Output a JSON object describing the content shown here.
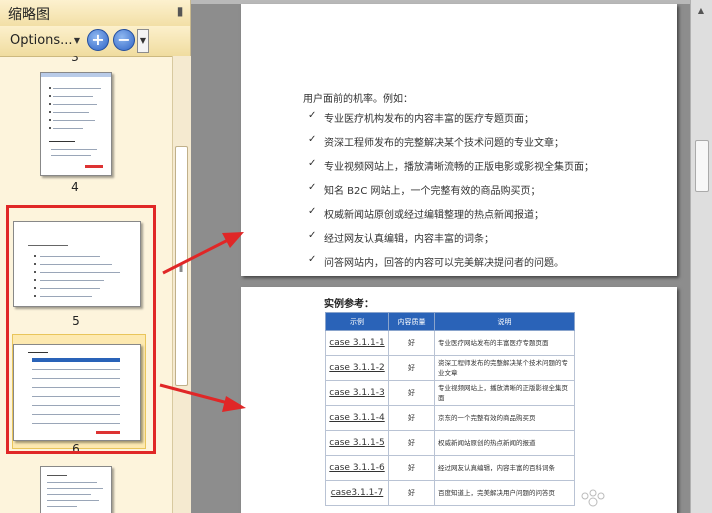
{
  "pane": {
    "title": "缩略图",
    "close_glyph": "▮",
    "options_label": "Options...",
    "zoom_in_label": "+",
    "zoom_out_label": "−"
  },
  "thumbnails": [
    {
      "label": "3"
    },
    {
      "label": "4"
    },
    {
      "label": "5"
    },
    {
      "label": "6"
    }
  ],
  "page1": {
    "intro": "用户面前的机率。例如：",
    "items": [
      "专业医疗机构发布的内容丰富的医疗专题页面；",
      "资深工程师发布的完整解决某个技术问题的专业文章；",
      "专业视频网站上，播放清晰流畅的正版电影或影视全集页面；",
      "知名 B2C 网站上，一个完整有效的商品购买页；",
      "权威新闻站原创或经过编辑整理的热点新闻报道；",
      "经过网友认真编辑，内容丰富的词条；",
      "问答网站内，回答的内容可以完美解决提问者的问题。"
    ]
  },
  "page2": {
    "title": "实例参考：",
    "headers": [
      "示例",
      "内容质量",
      "说明"
    ],
    "rows": [
      {
        "case": "case 3.1.1-1",
        "rating": "好",
        "desc": "专业医疗网站发布的丰富医疗专题页面"
      },
      {
        "case": "case 3.1.1-2",
        "rating": "好",
        "desc": "资深工程师发布的完整解决某个技术问题的专业文章"
      },
      {
        "case": "case 3.1.1-3",
        "rating": "好",
        "desc": "专业视频网站上，播放清晰的正版影视全集页面"
      },
      {
        "case": "case 3.1.1-4",
        "rating": "好",
        "desc": "京东的一个完整有效的商品购买页"
      },
      {
        "case": "case 3.1.1-5",
        "rating": "好",
        "desc": "权威新闻站原创的热点新闻的报道"
      },
      {
        "case": "case 3.1.1-6",
        "rating": "好",
        "desc": "经过网友认真编辑，内容丰富的百科词条"
      },
      {
        "case": "case3.1.1-7",
        "rating": "好",
        "desc": "百度知道上，完美解决用户问题的问答页"
      }
    ]
  },
  "colors": {
    "annotation_red": "#e02727",
    "table_header_blue": "#2a63b8",
    "pane_background": "#fdf4dc"
  }
}
